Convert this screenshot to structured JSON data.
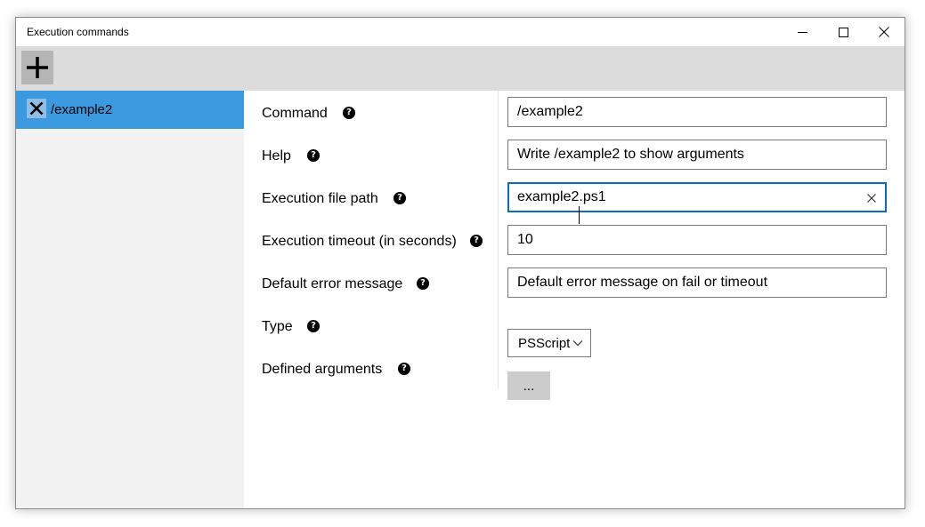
{
  "window": {
    "title": "Execution commands"
  },
  "sidebar": {
    "items": [
      {
        "label": "/example2",
        "selected": true
      }
    ]
  },
  "form": {
    "command": {
      "label": "Command",
      "value": "/example2"
    },
    "help": {
      "label": "Help",
      "value": "Write /example2 to show arguments"
    },
    "exec_path": {
      "label": "Execution file path",
      "value": "example2.ps1"
    },
    "exec_timeout": {
      "label": "Execution timeout (in seconds)",
      "value": "10"
    },
    "default_error": {
      "label": "Default error message",
      "value": "Default error message on fail or timeout"
    },
    "type": {
      "label": "Type",
      "value": "PSScript"
    },
    "defined_args": {
      "label": "Defined arguments",
      "button_label": "..."
    }
  },
  "icons": {
    "minimize": "minimize-icon",
    "maximize": "maximize-icon",
    "close": "close-icon",
    "add": "plus-icon",
    "delete": "x-icon",
    "help": "question-icon",
    "clear": "clear-icon",
    "dropdown": "chevron-down-icon"
  },
  "colors": {
    "selected_item": "#3b99e0",
    "toolbar": "#dcdcdc",
    "sidebar": "#f2f2f2",
    "focus_border": "#0b6cbd"
  }
}
